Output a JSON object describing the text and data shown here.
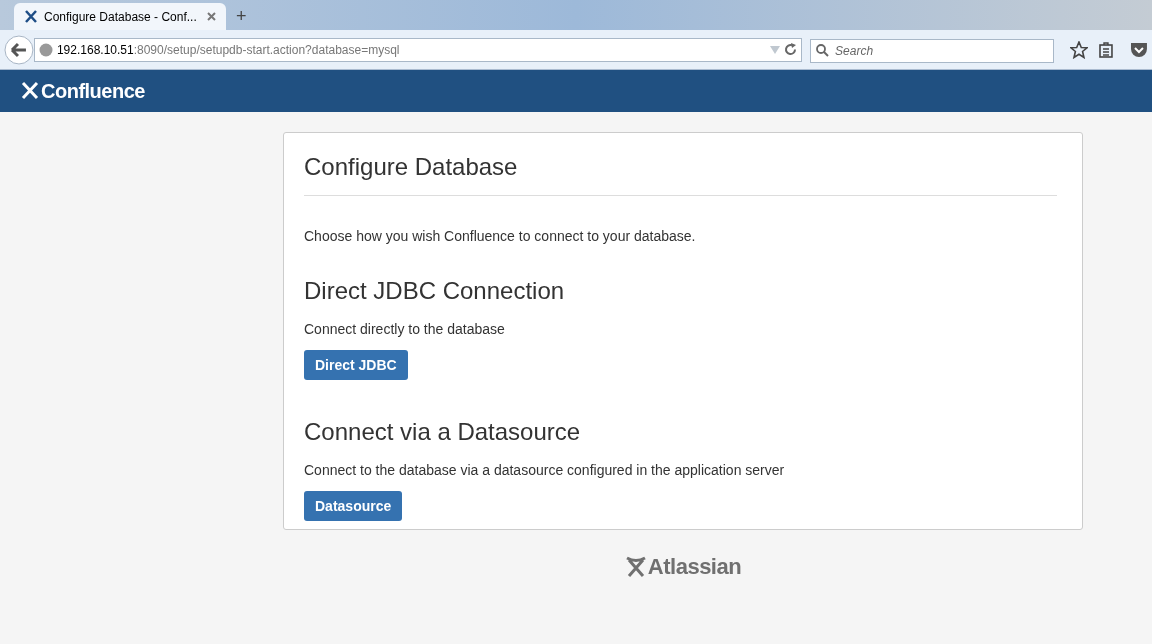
{
  "browser": {
    "tab": {
      "title": "Configure Database - Conf...",
      "selected": true
    },
    "new_tab": "+",
    "url": {
      "host": "192.168.10.51",
      "path": ":8090/setup/setupdb-start.action?database=mysql"
    },
    "search": {
      "placeholder": "Search"
    }
  },
  "header": {
    "logo": "Confluence"
  },
  "panel": {
    "title": "Configure Database",
    "intro": "Choose how you wish Confluence to connect to your database.",
    "sections": [
      {
        "heading": "Direct JDBC Connection",
        "description": "Connect directly to the database",
        "button": "Direct JDBC"
      },
      {
        "heading": "Connect via a Datasource",
        "description": "Connect to the database via a datasource configured in the application server",
        "button": "Datasource"
      }
    ]
  },
  "footer": {
    "logo": "Atlassian"
  }
}
